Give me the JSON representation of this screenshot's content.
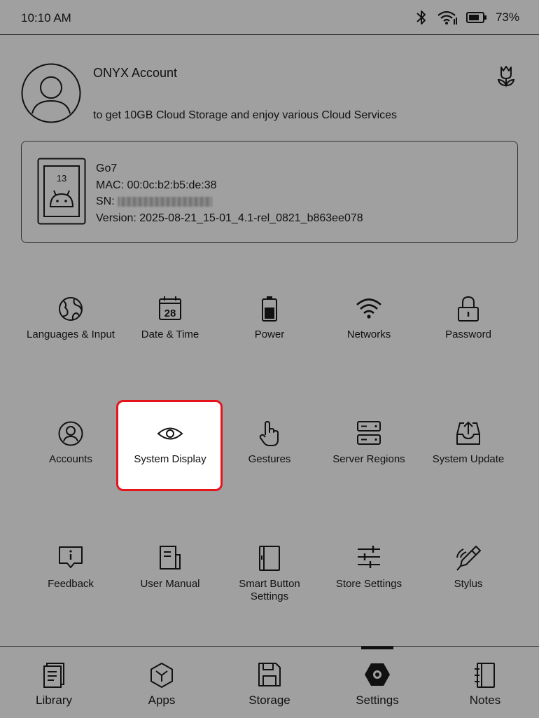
{
  "status": {
    "time": "10:10 AM",
    "battery": "73%"
  },
  "account": {
    "title": "ONYX Account",
    "subtitle": "to get 10GB Cloud Storage and enjoy various Cloud Services"
  },
  "device": {
    "android_version": "13",
    "name": "Go7",
    "mac": "MAC: 00:0c:b2:b5:de:38",
    "sn_label": "SN:",
    "version": "Version: 2025-08-21_15-01_4.1-rel_0821_b863ee078"
  },
  "settings": {
    "row1": [
      {
        "label": "Languages & Input",
        "icon": "globe-icon"
      },
      {
        "label": "Date & Time",
        "icon": "calendar-icon",
        "day": "28"
      },
      {
        "label": "Power",
        "icon": "battery-icon"
      },
      {
        "label": "Networks",
        "icon": "wifi-icon"
      },
      {
        "label": "Password",
        "icon": "lock-icon"
      }
    ],
    "row2": [
      {
        "label": "Accounts",
        "icon": "person-icon"
      },
      {
        "label": "System Display",
        "icon": "eye-icon"
      },
      {
        "label": "Gestures",
        "icon": "hand-pointer-icon"
      },
      {
        "label": "Server Regions",
        "icon": "server-icon"
      },
      {
        "label": "System Update",
        "icon": "upload-tray-icon"
      }
    ],
    "row3": [
      {
        "label": "Feedback",
        "icon": "feedback-icon"
      },
      {
        "label": "User Manual",
        "icon": "manual-icon"
      },
      {
        "label_line1": "Smart Button",
        "label_line2": "Settings",
        "icon": "smart-button-icon"
      },
      {
        "label": "Store Settings",
        "icon": "sliders-icon"
      },
      {
        "label": "Stylus",
        "icon": "stylus-icon"
      }
    ]
  },
  "nav": [
    {
      "label": "Library",
      "icon": "library-icon"
    },
    {
      "label": "Apps",
      "icon": "apps-icon"
    },
    {
      "label": "Storage",
      "icon": "save-icon"
    },
    {
      "label": "Settings",
      "icon": "settings-hex-icon",
      "active": true
    },
    {
      "label": "Notes",
      "icon": "notebook-icon"
    }
  ]
}
